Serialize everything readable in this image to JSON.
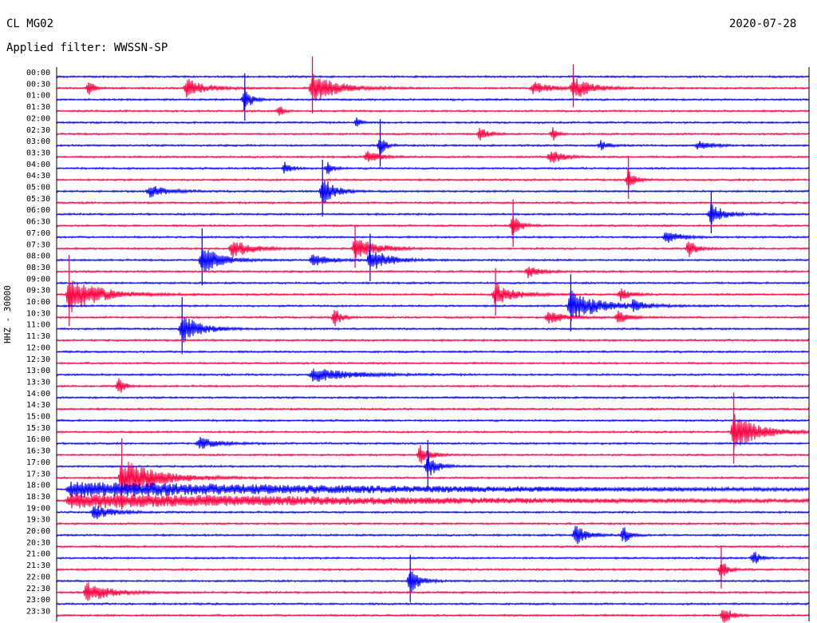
{
  "header": {
    "station": "CL MG02",
    "filter": "Applied filter: WWSSN-SP",
    "date": "2020-07-28",
    "channel": "HHZ - 30000"
  },
  "colors": {
    "trace_a": "#ff0040",
    "trace_b": "#0000ff",
    "text": "#000000",
    "background": "#ffffff"
  },
  "chart_data": {
    "type": "line",
    "title": "",
    "xlabel": "",
    "ylabel": "HHZ - 30000",
    "row_labels": [
      "00:00",
      "00:30",
      "01:00",
      "01:30",
      "02:00",
      "02:30",
      "03:00",
      "03:30",
      "04:00",
      "04:30",
      "05:00",
      "05:30",
      "06:00",
      "06:30",
      "07:00",
      "07:30",
      "08:00",
      "08:30",
      "09:00",
      "09:30",
      "10:00",
      "10:30",
      "11:00",
      "11:30",
      "12:00",
      "12:30",
      "13:00",
      "13:30",
      "14:00",
      "14:30",
      "15:00",
      "15:30",
      "16:00",
      "16:30",
      "17:00",
      "17:30",
      "18:00",
      "18:30",
      "19:00",
      "19:30",
      "20:00",
      "20:30",
      "21:00",
      "21:30",
      "22:00",
      "22:30",
      "23:00",
      "23:30"
    ],
    "row_colors": [
      "trace_b",
      "trace_a",
      "trace_b",
      "trace_a",
      "trace_b",
      "trace_a",
      "trace_b",
      "trace_a",
      "trace_b",
      "trace_a",
      "trace_b",
      "trace_a",
      "trace_b",
      "trace_a",
      "trace_b",
      "trace_a",
      "trace_b",
      "trace_a",
      "trace_b",
      "trace_a",
      "trace_b",
      "trace_a",
      "trace_b",
      "trace_a",
      "trace_b",
      "trace_a",
      "trace_b",
      "trace_a",
      "trace_b",
      "trace_a",
      "trace_b",
      "trace_a",
      "trace_b",
      "trace_a",
      "trace_b",
      "trace_a",
      "trace_b",
      "trace_a",
      "trace_b",
      "trace_a",
      "trace_b",
      "trace_a",
      "trace_b",
      "trace_a",
      "trace_b",
      "trace_a",
      "trace_b",
      "trace_a"
    ],
    "row_minutes": 30,
    "events": [
      {
        "row": 1,
        "minute": 1.3,
        "amp": 0.6,
        "dur": 0.5
      },
      {
        "row": 1,
        "minute": 5.2,
        "amp": 0.8,
        "dur": 1.5
      },
      {
        "row": 1,
        "minute": 10.2,
        "amp": 1.2,
        "dur": 2.0
      },
      {
        "row": 1,
        "minute": 19.0,
        "amp": 0.5,
        "dur": 1.5
      },
      {
        "row": 1,
        "minute": 20.6,
        "amp": 0.9,
        "dur": 1.5
      },
      {
        "row": 2,
        "minute": 7.5,
        "amp": 1.0,
        "dur": 0.6
      },
      {
        "row": 3,
        "minute": 8.9,
        "amp": 0.5,
        "dur": 0.3
      },
      {
        "row": 4,
        "minute": 12.0,
        "amp": 0.5,
        "dur": 0.3
      },
      {
        "row": 5,
        "minute": 16.9,
        "amp": 0.6,
        "dur": 0.6
      },
      {
        "row": 5,
        "minute": 19.8,
        "amp": 0.6,
        "dur": 0.3
      },
      {
        "row": 6,
        "minute": 12.9,
        "amp": 1.0,
        "dur": 0.4
      },
      {
        "row": 6,
        "minute": 21.7,
        "amp": 0.4,
        "dur": 0.6
      },
      {
        "row": 6,
        "minute": 25.6,
        "amp": 0.4,
        "dur": 1.0
      },
      {
        "row": 7,
        "minute": 12.4,
        "amp": 0.5,
        "dur": 1.0
      },
      {
        "row": 7,
        "minute": 19.7,
        "amp": 0.6,
        "dur": 1.0
      },
      {
        "row": 8,
        "minute": 9.1,
        "amp": 0.5,
        "dur": 0.5
      },
      {
        "row": 8,
        "minute": 10.8,
        "amp": 0.5,
        "dur": 0.5
      },
      {
        "row": 9,
        "minute": 22.8,
        "amp": 0.9,
        "dur": 0.5
      },
      {
        "row": 10,
        "minute": 10.6,
        "amp": 1.2,
        "dur": 1.0
      },
      {
        "row": 10,
        "minute": 3.7,
        "amp": 0.5,
        "dur": 1.5
      },
      {
        "row": 12,
        "minute": 26.1,
        "amp": 0.9,
        "dur": 1.0
      },
      {
        "row": 13,
        "minute": 18.2,
        "amp": 1.0,
        "dur": 0.6
      },
      {
        "row": 14,
        "minute": 24.3,
        "amp": 0.5,
        "dur": 1.2
      },
      {
        "row": 15,
        "minute": 7.0,
        "amp": 0.8,
        "dur": 1.5
      },
      {
        "row": 15,
        "minute": 11.9,
        "amp": 0.9,
        "dur": 1.8
      },
      {
        "row": 15,
        "minute": 25.2,
        "amp": 0.7,
        "dur": 0.7
      },
      {
        "row": 16,
        "minute": 5.8,
        "amp": 1.2,
        "dur": 1.5
      },
      {
        "row": 16,
        "minute": 12.5,
        "amp": 1.0,
        "dur": 1.5
      },
      {
        "row": 16,
        "minute": 10.2,
        "amp": 0.5,
        "dur": 1.5
      },
      {
        "row": 17,
        "minute": 18.8,
        "amp": 0.5,
        "dur": 1.0
      },
      {
        "row": 19,
        "minute": 0.5,
        "amp": 1.5,
        "dur": 2.5
      },
      {
        "row": 19,
        "minute": 17.5,
        "amp": 1.0,
        "dur": 1.5
      },
      {
        "row": 19,
        "minute": 22.5,
        "amp": 0.5,
        "dur": 0.8
      },
      {
        "row": 20,
        "minute": 20.5,
        "amp": 1.2,
        "dur": 2.5
      },
      {
        "row": 20,
        "minute": 23.0,
        "amp": 0.5,
        "dur": 0.8
      },
      {
        "row": 21,
        "minute": 11.1,
        "amp": 0.8,
        "dur": 0.5
      },
      {
        "row": 21,
        "minute": 19.6,
        "amp": 0.5,
        "dur": 1.5
      },
      {
        "row": 21,
        "minute": 22.4,
        "amp": 0.5,
        "dur": 0.8
      },
      {
        "row": 22,
        "minute": 5.0,
        "amp": 1.2,
        "dur": 1.5
      },
      {
        "row": 26,
        "minute": 10.2,
        "amp": 0.6,
        "dur": 3.0
      },
      {
        "row": 27,
        "minute": 2.5,
        "amp": 0.8,
        "dur": 0.4
      },
      {
        "row": 31,
        "minute": 27.0,
        "amp": 1.5,
        "dur": 2.0
      },
      {
        "row": 32,
        "minute": 5.7,
        "amp": 0.5,
        "dur": 1.5
      },
      {
        "row": 33,
        "minute": 14.5,
        "amp": 0.8,
        "dur": 0.8
      },
      {
        "row": 34,
        "minute": 14.8,
        "amp": 1.0,
        "dur": 0.8
      },
      {
        "row": 35,
        "minute": 2.6,
        "amp": 1.5,
        "dur": 3.0
      },
      {
        "row": 36,
        "minute": 0.5,
        "amp": 0.6,
        "dur": 29.0
      },
      {
        "row": 37,
        "minute": 0.5,
        "amp": 0.6,
        "dur": 29.0
      },
      {
        "row": 38,
        "minute": 1.5,
        "amp": 0.6,
        "dur": 1.5
      },
      {
        "row": 40,
        "minute": 20.7,
        "amp": 0.8,
        "dur": 1.0
      },
      {
        "row": 40,
        "minute": 22.6,
        "amp": 0.8,
        "dur": 0.5
      },
      {
        "row": 42,
        "minute": 27.8,
        "amp": 0.6,
        "dur": 0.5
      },
      {
        "row": 43,
        "minute": 26.5,
        "amp": 0.9,
        "dur": 0.5
      },
      {
        "row": 44,
        "minute": 14.1,
        "amp": 1.0,
        "dur": 0.8
      },
      {
        "row": 45,
        "minute": 1.2,
        "amp": 0.8,
        "dur": 2.0
      },
      {
        "row": 47,
        "minute": 26.6,
        "amp": 0.8,
        "dur": 0.6
      }
    ]
  }
}
